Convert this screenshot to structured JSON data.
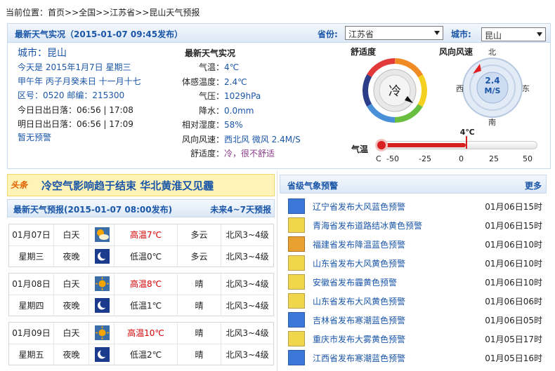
{
  "breadcrumb": {
    "prefix": "当前位置：",
    "items": [
      "首页",
      "全国",
      "江苏省",
      "昆山天气预报"
    ],
    "sep": ">>"
  },
  "obs": {
    "title": "最新天气实况（2015-01-07  09:45发布）",
    "province_label": "省份:",
    "province_value": "江苏省",
    "city_label": "城市:",
    "city_value": "昆山",
    "city_line": "城市：昆山",
    "today": "今天是 2015年1月7日 星期三",
    "lunar": "甲午年 丙子月癸未日 十一月十七",
    "codes": "区号：0520  邮编：215300",
    "sun_today": "今日日出日落：06:56 | 17:08",
    "sun_tomorrow": "明日日出日落：06:56 | 17:09",
    "warning": "暂无预警",
    "live_title": "最新天气实况",
    "fields": [
      {
        "label": "气温：",
        "value": "4℃"
      },
      {
        "label": "体感温度：",
        "value": "2.4℃"
      },
      {
        "label": "气压：",
        "value": "1029hPa"
      },
      {
        "label": "降水：",
        "value": "0.0mm"
      },
      {
        "label": "相对湿度：",
        "value": "58%"
      },
      {
        "label": "风向风速：",
        "value": "西北风 微风 2.4M/S"
      },
      {
        "label": "舒适度：",
        "value": "冷，很不舒适"
      }
    ],
    "comfort_title": "舒适度",
    "comfort_value": "冷",
    "wind_title": "风向风速",
    "wind_value": "2.4",
    "wind_unit": "M/S",
    "compass": {
      "n": "北",
      "s": "南",
      "e": "东",
      "w": "西"
    },
    "temp_title": "气温",
    "temp_value_label": "4℃",
    "temp_value": 4,
    "temp_scale": {
      "unit": "C",
      "ticks": [
        "-50",
        "-25",
        "0",
        "25",
        "50"
      ],
      "min": -50,
      "max": 50
    }
  },
  "headline": {
    "tag": "头条",
    "text": "冷空气影响趋于结束 华北黄淮又见霾"
  },
  "forecast": {
    "title": "最新天气预报(2015-01-07  08:00发布)",
    "more": "未来4~7天预报",
    "days": [
      {
        "date": "01月07日",
        "weekday": "星期三",
        "day": {
          "period": "白天",
          "temp": "高温7℃",
          "weather": "多云",
          "wind": "北风3~4级",
          "icon": "cloudy-sun-icon"
        },
        "night": {
          "period": "夜晚",
          "temp": "低温0℃",
          "weather": "多云",
          "wind": "北风3~4级",
          "icon": "moon-icon"
        }
      },
      {
        "date": "01月08日",
        "weekday": "星期四",
        "day": {
          "period": "白天",
          "temp": "高温8℃",
          "weather": "晴",
          "wind": "北风3~4级",
          "icon": "sun-icon"
        },
        "night": {
          "period": "夜晚",
          "temp": "低温1℃",
          "weather": "晴",
          "wind": "北风3~4级",
          "icon": "moon-icon"
        }
      },
      {
        "date": "01月09日",
        "weekday": "星期五",
        "day": {
          "period": "白天",
          "temp": "高温10℃",
          "weather": "晴",
          "wind": "北风3~4级",
          "icon": "sun-icon"
        },
        "night": {
          "period": "夜晚",
          "temp": "低温2℃",
          "weather": "晴",
          "wind": "北风3~4级",
          "icon": "moon-icon"
        }
      }
    ]
  },
  "alerts": {
    "title": "省级气象预警",
    "more": "更多",
    "items": [
      {
        "text": "辽宁省发布大风蓝色预警",
        "time": "01月06日15时",
        "color": "blue"
      },
      {
        "text": "青海省发布道路结冰黄色预警",
        "time": "01月06日15时",
        "color": "yellow"
      },
      {
        "text": "福建省发布降温蓝色预警",
        "time": "01月06日10时",
        "color": "orange"
      },
      {
        "text": "山东省发布大风黄色预警",
        "time": "01月06日10时",
        "color": "yellow"
      },
      {
        "text": "安徽省发布霾黄色预警",
        "time": "01月06日10时",
        "color": "yellow"
      },
      {
        "text": "山东省发布大风黄色预警",
        "time": "01月06日06时",
        "color": "yellow"
      },
      {
        "text": "吉林省发布寒潮蓝色预警",
        "time": "01月06日05时",
        "color": "blue"
      },
      {
        "text": "重庆市发布大雾黄色预警",
        "time": "01月05日17时",
        "color": "yellow"
      },
      {
        "text": "江西省发布寒潮蓝色预警",
        "time": "01月05日16时",
        "color": "blue"
      }
    ]
  }
}
